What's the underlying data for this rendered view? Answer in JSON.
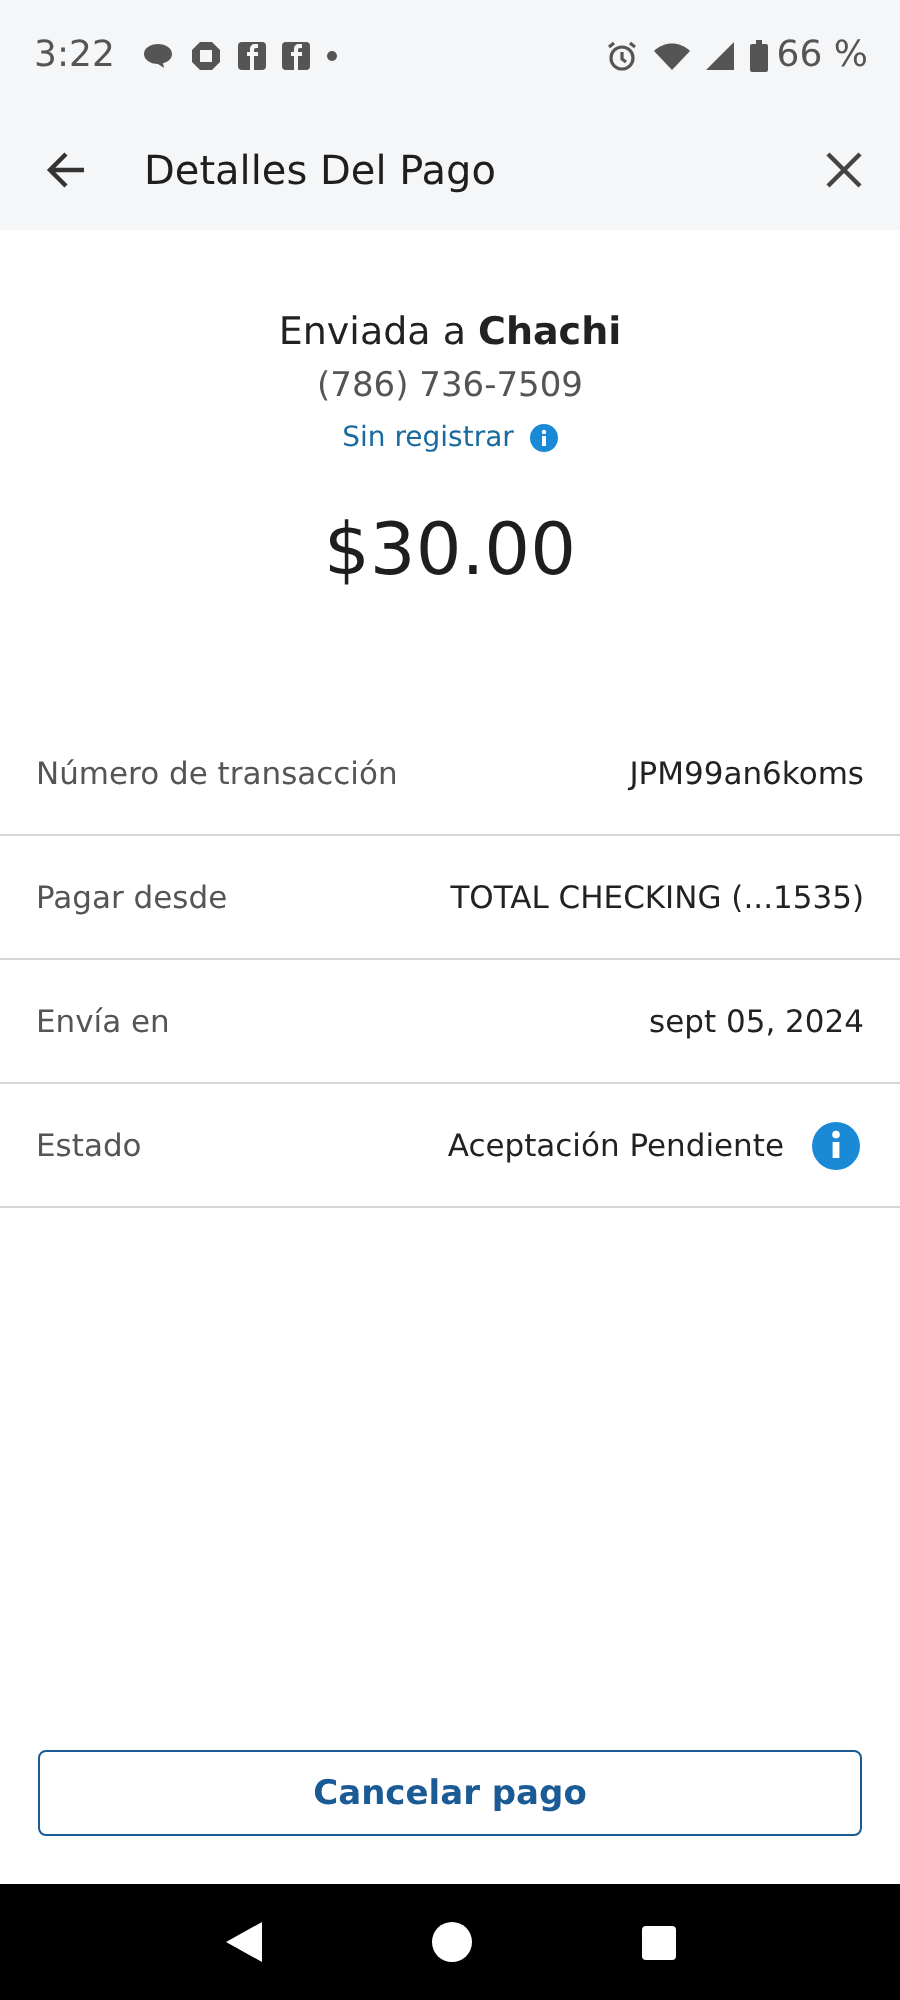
{
  "status_bar": {
    "time": "3:22",
    "battery": "66 %"
  },
  "header": {
    "title": "Detalles Del Pago"
  },
  "recipient": {
    "sent_to": "Enviada a **Chachi**",
    "phone": "(786) 736-7509",
    "registration": "Sin registrar"
  },
  "amount": "$30.00",
  "details": [
    {
      "label": "Número de transacción",
      "value": "JPM99an6koms",
      "info": false
    },
    {
      "label": "Pagar desde",
      "value": "TOTAL CHECKING (...1535)",
      "info": false
    },
    {
      "label": "Envía en",
      "value": "sept 05, 2024",
      "info": false
    },
    {
      "label": "Estado",
      "value": "Aceptación Pendiente",
      "info": true
    }
  ],
  "buttons": [
    "Cancelar pago"
  ]
}
